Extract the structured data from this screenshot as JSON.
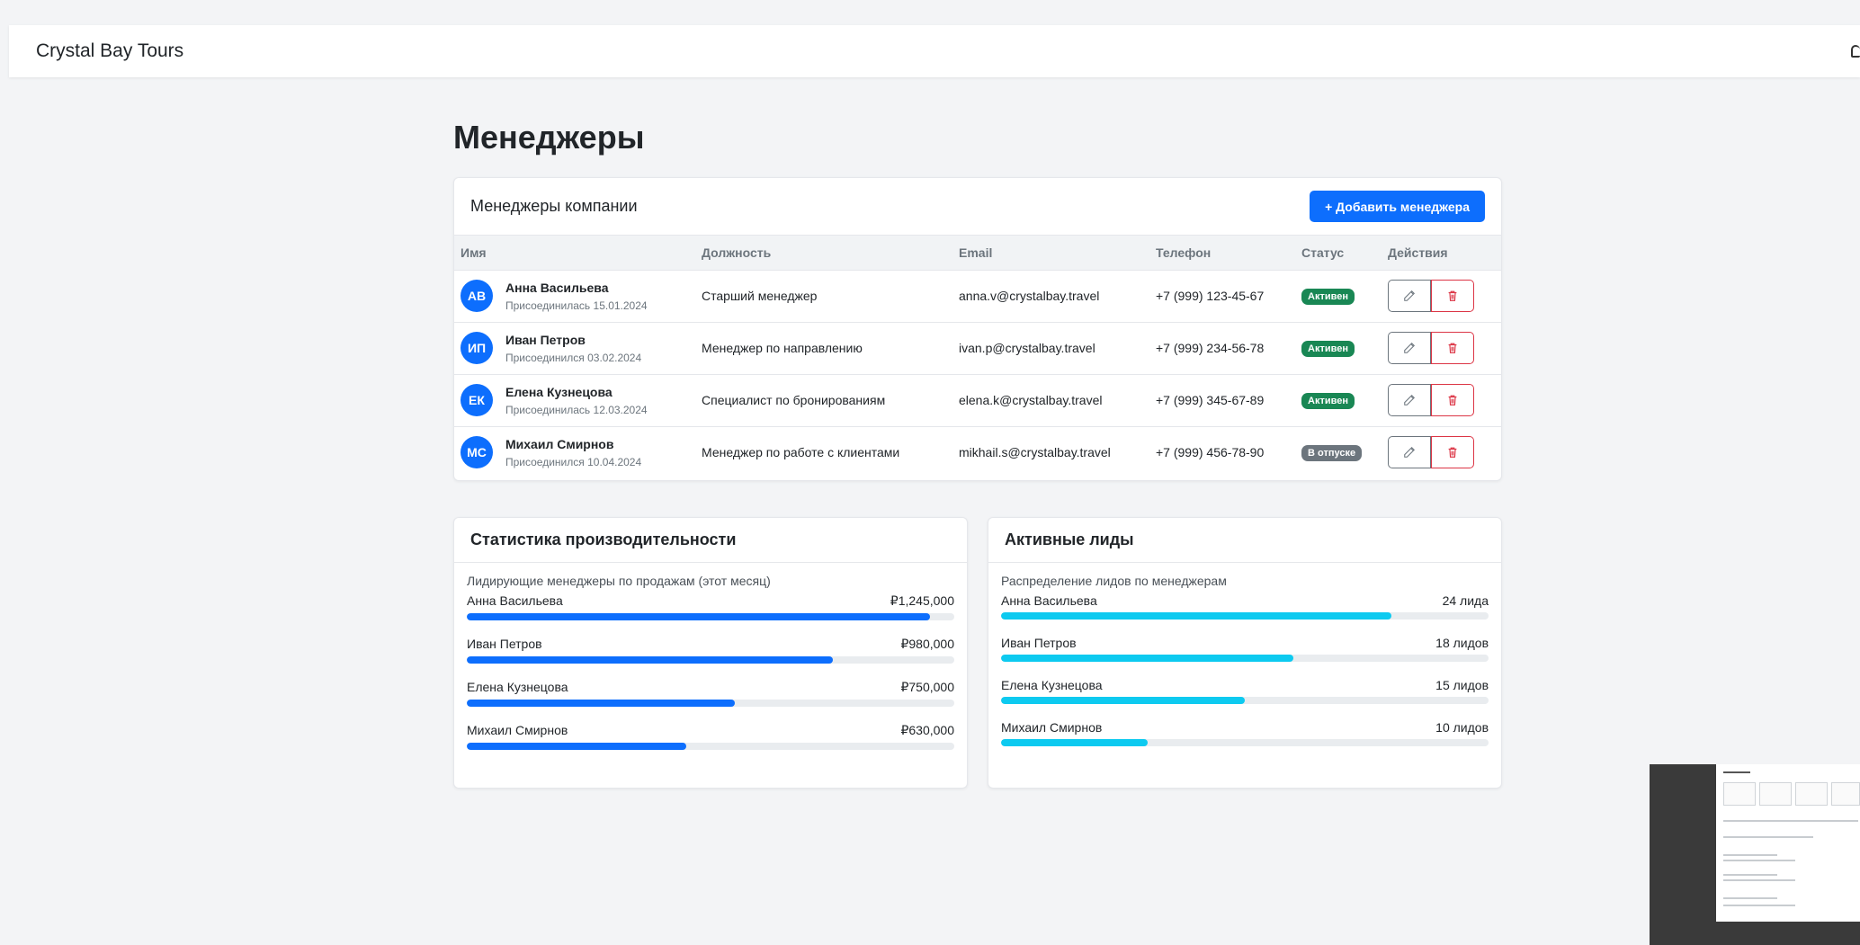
{
  "app": {
    "brand": "Crystal Bay Tours"
  },
  "page": {
    "title": "Менеджеры"
  },
  "managers_card": {
    "title": "Менеджеры компании",
    "add_button": "+ Добавить менеджера",
    "columns": [
      "Имя",
      "Должность",
      "Email",
      "Телефон",
      "Статус",
      "Действия"
    ],
    "rows": [
      {
        "initials": "АВ",
        "name": "Анна Васильева",
        "joined": "Присоединилась 15.01.2024",
        "position": "Старший менеджер",
        "email": "anna.v@crystalbay.travel",
        "phone": "+7 (999) 123-45-67",
        "status": "Активен",
        "status_type": "active"
      },
      {
        "initials": "ИП",
        "name": "Иван Петров",
        "joined": "Присоединился 03.02.2024",
        "position": "Менеджер по направлению",
        "email": "ivan.p@crystalbay.travel",
        "phone": "+7 (999) 234-56-78",
        "status": "Активен",
        "status_type": "active"
      },
      {
        "initials": "ЕК",
        "name": "Елена Кузнецова",
        "joined": "Присоединилась 12.03.2024",
        "position": "Специалист по бронированиям",
        "email": "elena.k@crystalbay.travel",
        "phone": "+7 (999) 345-67-89",
        "status": "Активен",
        "status_type": "active"
      },
      {
        "initials": "МС",
        "name": "Михаил Смирнов",
        "joined": "Присоединился 10.04.2024",
        "position": "Менеджер по работе с клиентами",
        "email": "mikhail.s@crystalbay.travel",
        "phone": "+7 (999) 456-78-90",
        "status": "В отпуске",
        "status_type": "vacation"
      }
    ]
  },
  "stats_card": {
    "title": "Статистика производительности",
    "subtitle": "Лидирующие менеджеры по продажам (этот месяц)",
    "items": [
      {
        "name": "Анна Васильева",
        "value": "₽1,245,000",
        "percent": 95
      },
      {
        "name": "Иван Петров",
        "value": "₽980,000",
        "percent": 75
      },
      {
        "name": "Елена Кузнецова",
        "value": "₽750,000",
        "percent": 55
      },
      {
        "name": "Михаил Смирнов",
        "value": "₽630,000",
        "percent": 45
      }
    ]
  },
  "leads_card": {
    "title": "Активные лиды",
    "subtitle": "Распределение лидов по менеджерам",
    "items": [
      {
        "name": "Анна Васильева",
        "value": "24 лида",
        "percent": 80
      },
      {
        "name": "Иван Петров",
        "value": "18 лидов",
        "percent": 60
      },
      {
        "name": "Елена Кузнецова",
        "value": "15 лидов",
        "percent": 50
      },
      {
        "name": "Михаил Смирнов",
        "value": "10 лидов",
        "percent": 30
      }
    ]
  },
  "colors": {
    "primary": "#0d6efd",
    "info": "#0dcaf0",
    "success": "#198754",
    "secondary": "#6c757d",
    "danger": "#dc3545"
  }
}
